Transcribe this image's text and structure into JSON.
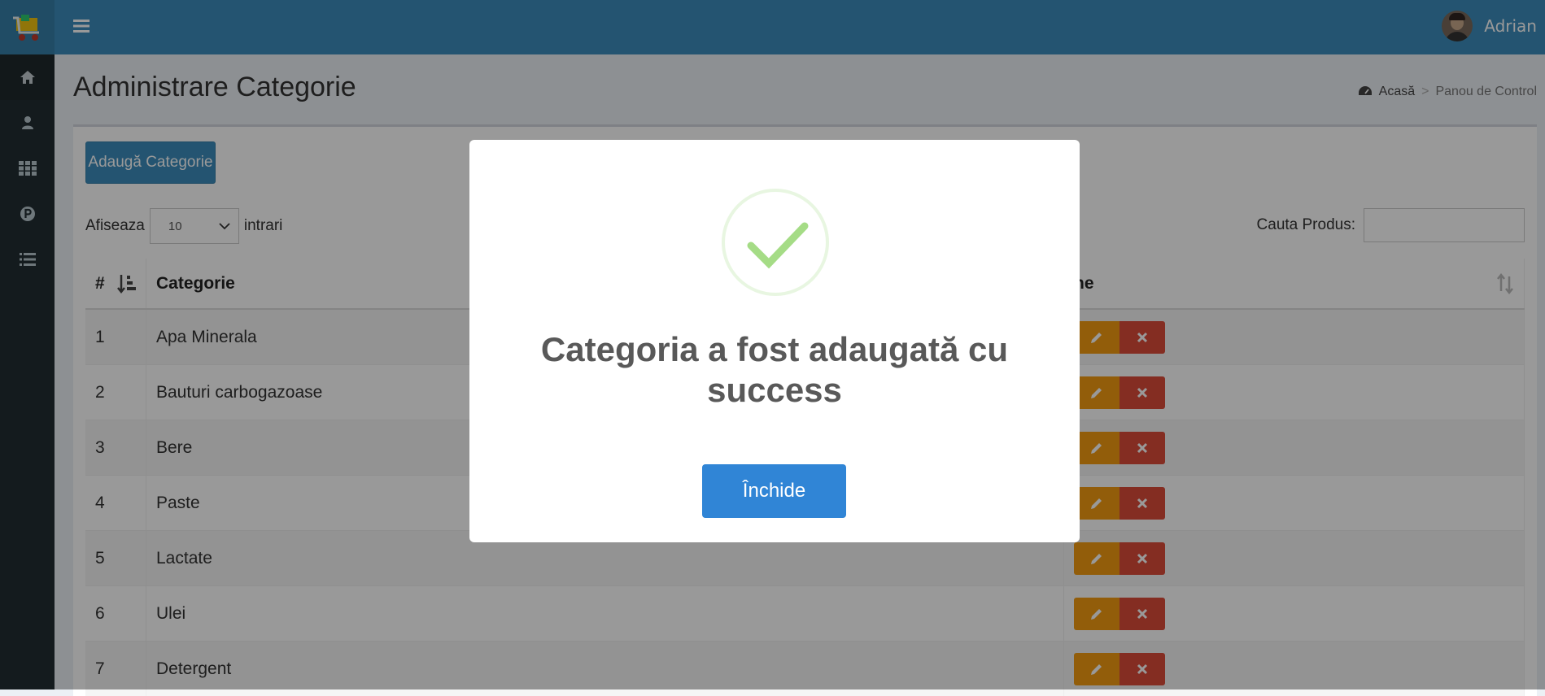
{
  "header": {
    "user_name": "Adrian"
  },
  "sidebar": {
    "items": [
      {
        "icon": "home-icon"
      },
      {
        "icon": "user-icon"
      },
      {
        "icon": "grid-icon"
      },
      {
        "icon": "parking-icon"
      },
      {
        "icon": "list-icon"
      }
    ]
  },
  "page": {
    "title": "Administrare Categorie",
    "breadcrumb_home": "Acasă",
    "breadcrumb_separator": ">",
    "breadcrumb_current": "Panou de Control"
  },
  "toolbar": {
    "add_label": "Adaugă Categorie",
    "show_label": "Afiseaza",
    "entries_value": "10",
    "entries_label": "intrari",
    "search_label": "Cauta Produs:",
    "search_value": ""
  },
  "table": {
    "headers": [
      "#",
      "Categorie",
      "ne"
    ],
    "rows": [
      {
        "id": "1",
        "name": "Apa Minerala"
      },
      {
        "id": "2",
        "name": "Bauturi carbogazoase"
      },
      {
        "id": "3",
        "name": "Bere"
      },
      {
        "id": "4",
        "name": "Paste"
      },
      {
        "id": "5",
        "name": "Lactate"
      },
      {
        "id": "6",
        "name": "Ulei"
      },
      {
        "id": "7",
        "name": "Detergent"
      }
    ]
  },
  "modal": {
    "title": "Categoria a fost adaugată cu success",
    "close_label": "Închide"
  },
  "colors": {
    "header": "#3c8dbc",
    "sidebar": "#222d32",
    "edit": "#f39c12",
    "delete": "#dd4b39",
    "success": "#a5dc86",
    "modal_button": "#3085d6"
  }
}
